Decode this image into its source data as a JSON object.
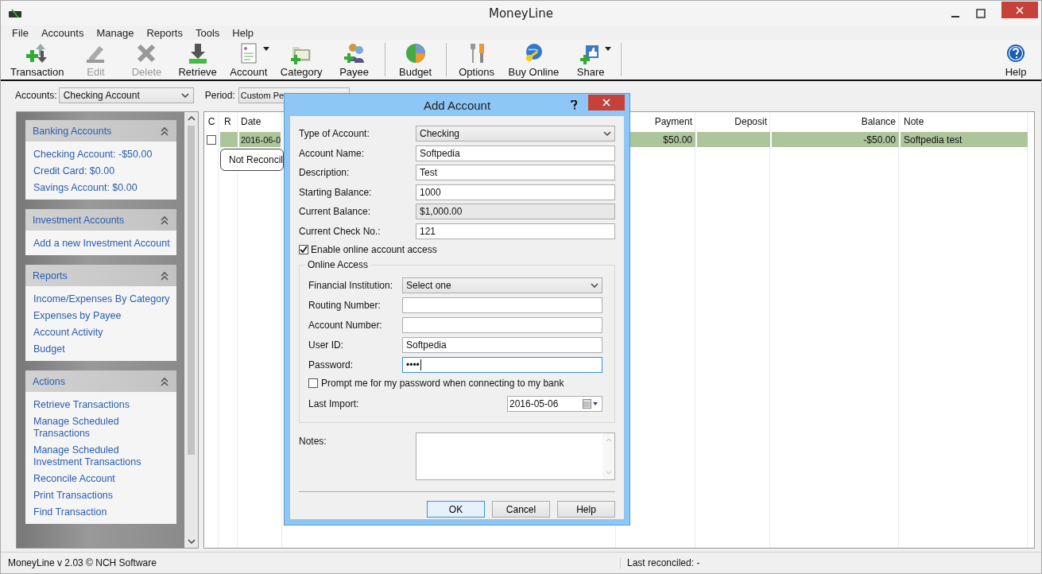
{
  "window": {
    "title": "MoneyLine"
  },
  "menu": [
    "File",
    "Accounts",
    "Manage",
    "Reports",
    "Tools",
    "Help"
  ],
  "toolbar": [
    {
      "kind": "transaction",
      "label": "Transaction",
      "disabled": false,
      "has_menu": false
    },
    {
      "kind": "edit",
      "label": "Edit",
      "disabled": true,
      "has_menu": false
    },
    {
      "kind": "delete",
      "label": "Delete",
      "disabled": true,
      "has_menu": false
    },
    {
      "kind": "retrieve",
      "label": "Retrieve",
      "disabled": false,
      "has_menu": false
    },
    {
      "kind": "account",
      "label": "Account",
      "disabled": false,
      "has_menu": true
    },
    {
      "kind": "category",
      "label": "Category",
      "disabled": false,
      "has_menu": false
    },
    {
      "kind": "payee",
      "label": "Payee",
      "disabled": false,
      "has_menu": false
    },
    {
      "kind": "separator"
    },
    {
      "kind": "budget",
      "label": "Budget",
      "disabled": false,
      "has_menu": false
    },
    {
      "kind": "separator"
    },
    {
      "kind": "options",
      "label": "Options",
      "disabled": false,
      "has_menu": false
    },
    {
      "kind": "buy",
      "label": "Buy Online",
      "disabled": false,
      "has_menu": false
    },
    {
      "kind": "share",
      "label": "Share",
      "disabled": false,
      "has_menu": true
    },
    {
      "kind": "separator"
    }
  ],
  "toolbar_right": {
    "kind": "help",
    "label": "Help"
  },
  "filters": {
    "accounts_label": "Accounts:",
    "accounts_value": "Checking Account",
    "period_label": "Period:",
    "period_value": "Custom Pe"
  },
  "sidebar": [
    {
      "title": "Banking Accounts",
      "items": [
        "Checking Account: -$50.00",
        "Credit Card: $0.00",
        "Savings Account: $0.00"
      ]
    },
    {
      "title": "Investment Accounts",
      "items": [
        "Add a new Investment Account"
      ]
    },
    {
      "title": "Reports",
      "items": [
        "Income/Expenses By Category",
        "Expenses by Payee",
        "Account Activity",
        "Budget"
      ]
    },
    {
      "title": "Actions",
      "items": [
        "Retrieve Transactions",
        "Manage Scheduled Transactions",
        "Manage Scheduled Investment Transactions",
        "Reconcile Account",
        "Print Transactions",
        "Find Transaction"
      ]
    }
  ],
  "table": {
    "columns": [
      "C",
      "R",
      "Date",
      "Payment",
      "Deposit",
      "Balance",
      "Note"
    ],
    "rows": [
      {
        "checked": false,
        "date": "2016-06-0",
        "payment": "$50.00",
        "balance": "-$50.00",
        "note": "Softpedia test"
      }
    ],
    "tooltip": "Not Reconcil"
  },
  "dialog": {
    "title": "Add Account",
    "fields": [
      {
        "kind": "select",
        "label": "Type of Account:",
        "value": "Checking"
      },
      {
        "kind": "input",
        "label": "Account Name:",
        "value": "Softpedia"
      },
      {
        "kind": "input",
        "label": "Description:",
        "value": "Test"
      },
      {
        "kind": "input",
        "label": "Starting Balance:",
        "value": "1000"
      },
      {
        "kind": "readonly",
        "label": "Current Balance:",
        "value": "$1,000.00"
      },
      {
        "kind": "input",
        "label": "Current Check No.:",
        "value": "121"
      }
    ],
    "online_checkbox": {
      "label": "Enable online account access",
      "checked": true
    },
    "group": {
      "title": "Online Access",
      "fields": [
        {
          "kind": "select",
          "label": "Financial Institution:",
          "value": "Select one"
        },
        {
          "kind": "input",
          "label": "Routing Number:"
        },
        {
          "kind": "input",
          "label": "Account Number:"
        },
        {
          "kind": "input",
          "label": "User ID:",
          "value": "Softpedia"
        },
        {
          "kind": "password",
          "label": "Password:",
          "value": "••••"
        }
      ],
      "prompt_checkbox": {
        "label": "Prompt me for my password when connecting to my bank",
        "checked": false
      },
      "last_import": {
        "label": "Last Import:",
        "value": "2016-05-06"
      }
    },
    "notes_label": "Notes:",
    "buttons": [
      {
        "label": "OK",
        "default": true
      },
      {
        "label": "Cancel",
        "default": false
      },
      {
        "label": "Help",
        "default": false
      }
    ]
  },
  "status_bar": {
    "left": "MoneyLine v 2.03 © NCH Software",
    "right": "Last reconciled: -"
  }
}
